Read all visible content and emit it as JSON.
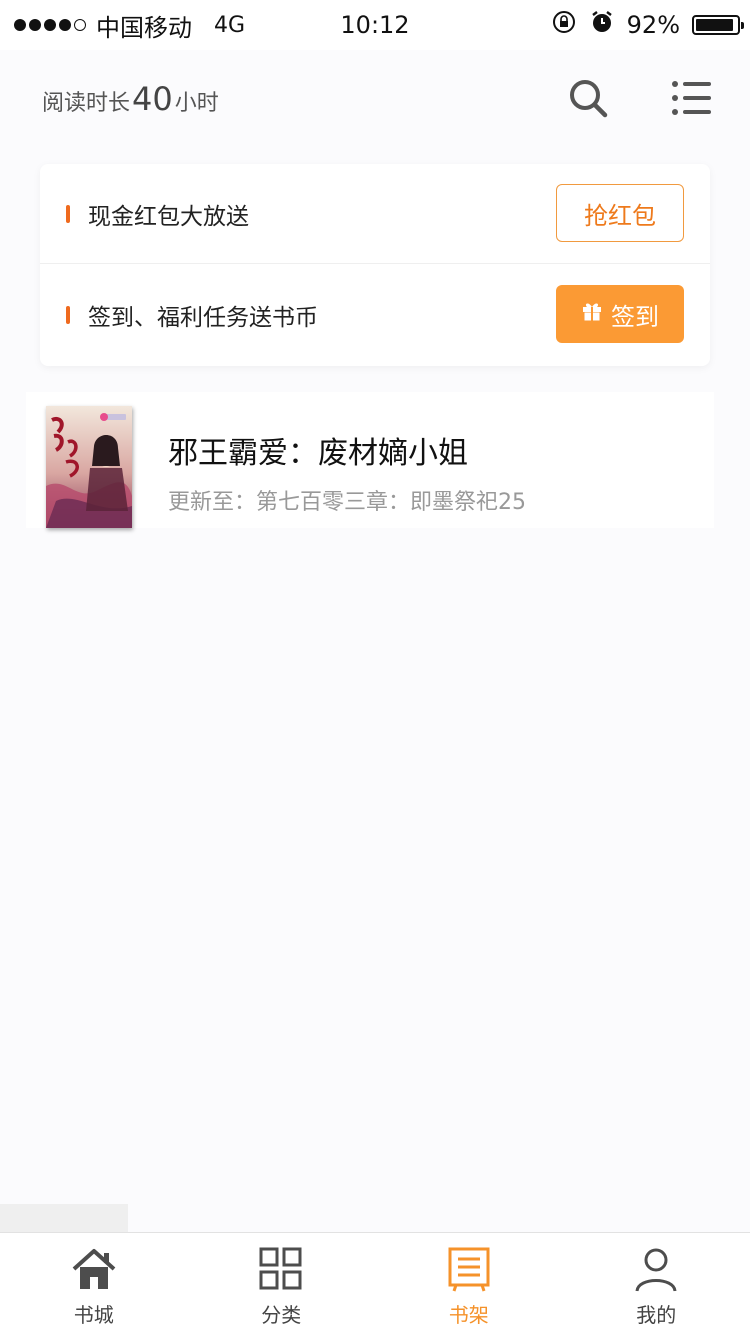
{
  "status_bar": {
    "carrier": "中国移动",
    "network": "4G",
    "time": "10:12",
    "battery_text": "92%",
    "battery_level": 0.92
  },
  "header": {
    "reading_prefix": "阅读时长",
    "reading_hours": "40",
    "reading_suffix": "小时",
    "icons": [
      "search-icon",
      "list-menu-icon"
    ]
  },
  "promo": {
    "row1_text": "现金红包大放送",
    "row1_button": "抢红包",
    "row2_text": "签到、福利任务送书币",
    "row2_button": "签到",
    "accent_color": "#f5922a"
  },
  "bookshelf": [
    {
      "title": "邪王霸爱：废材嫡小姐",
      "update": "更新至：第七百零三章：即墨祭祀25"
    }
  ],
  "tabs": [
    {
      "label": "书城",
      "icon": "home-icon",
      "active": false
    },
    {
      "label": "分类",
      "icon": "grid-icon",
      "active": false
    },
    {
      "label": "书架",
      "icon": "bookshelf-icon",
      "active": true
    },
    {
      "label": "我的",
      "icon": "user-icon",
      "active": false
    }
  ]
}
